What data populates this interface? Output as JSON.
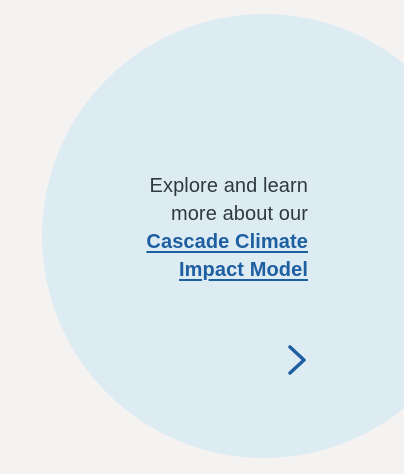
{
  "promo": {
    "line1": "Explore and learn",
    "line2": "more about our",
    "link_line1": "Cascade Climate",
    "link_line2": "Impact Model"
  },
  "icons": {
    "arrow": "chevron-right-icon"
  },
  "colors": {
    "page_background": "#f5f3f1",
    "circle_background": "#ddebf3",
    "text": "#2f3a40",
    "link": "#1e5fa2",
    "arrow": "#1e5fa2"
  }
}
